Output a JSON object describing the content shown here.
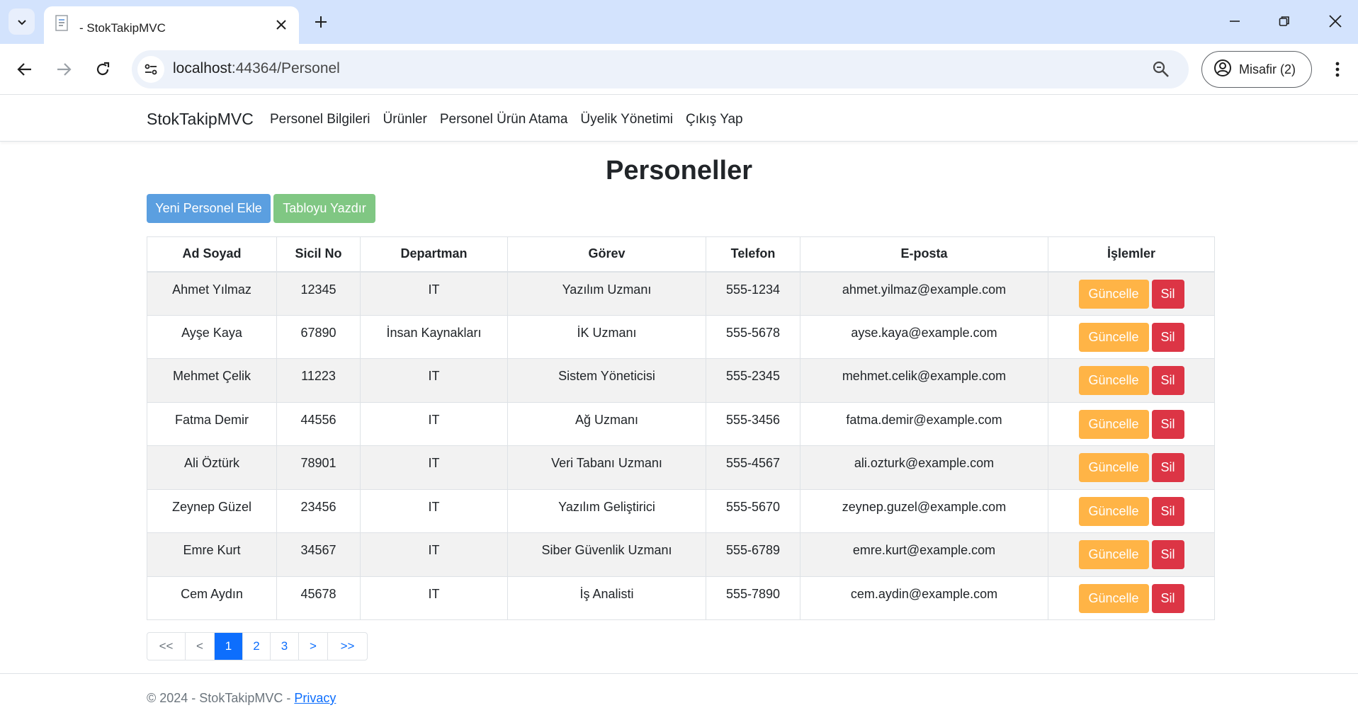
{
  "browser": {
    "tab_title": "- StokTakipMVC",
    "url_host": "localhost",
    "url_path": ":44364/Personel",
    "profile_label": "Misafir (2)",
    "icons": [
      "tab-list-icon",
      "favicon-icon",
      "close-icon",
      "plus-icon",
      "minimize-icon",
      "restore-icon",
      "close-window-icon",
      "back-arrow-icon",
      "forward-arrow-icon",
      "reload-icon",
      "site-info-icon",
      "zoom-icon",
      "profile-icon",
      "more-vert-icon"
    ]
  },
  "navbar": {
    "brand": "StokTakipMVC",
    "links": [
      "Personel Bilgileri",
      "Ürünler",
      "Personel Ürün Atama",
      "Üyelik Yönetimi",
      "Çıkış Yap"
    ]
  },
  "main": {
    "title": "Personeller",
    "add_button": "Yeni Personel Ekle",
    "print_button": "Tabloyu Yazdır"
  },
  "table": {
    "headers": [
      "Ad Soyad",
      "Sicil No",
      "Departman",
      "Görev",
      "Telefon",
      "E-posta",
      "İşlemler"
    ],
    "update_label": "Güncelle",
    "delete_label": "Sil",
    "rows": [
      [
        "Ahmet Yılmaz",
        "12345",
        "IT",
        "Yazılım Uzmanı",
        "555-1234",
        "ahmet.yilmaz@example.com"
      ],
      [
        "Ayşe Kaya",
        "67890",
        "İnsan Kaynakları",
        "İK Uzmanı",
        "555-5678",
        "ayse.kaya@example.com"
      ],
      [
        "Mehmet Çelik",
        "11223",
        "IT",
        "Sistem Yöneticisi",
        "555-2345",
        "mehmet.celik@example.com"
      ],
      [
        "Fatma Demir",
        "44556",
        "IT",
        "Ağ Uzmanı",
        "555-3456",
        "fatma.demir@example.com"
      ],
      [
        "Ali Öztürk",
        "78901",
        "IT",
        "Veri Tabanı Uzmanı",
        "555-4567",
        "ali.ozturk@example.com"
      ],
      [
        "Zeynep Güzel",
        "23456",
        "IT",
        "Yazılım Geliştirici",
        "555-5670",
        "zeynep.guzel@example.com"
      ],
      [
        "Emre Kurt",
        "34567",
        "IT",
        "Siber Güvenlik Uzmanı",
        "555-6789",
        "emre.kurt@example.com"
      ],
      [
        "Cem Aydın",
        "45678",
        "IT",
        "İş Analisti",
        "555-7890",
        "cem.aydin@example.com"
      ]
    ]
  },
  "pagination": {
    "items": [
      "<<",
      "<",
      "1",
      "2",
      "3",
      ">",
      ">>"
    ],
    "active": "1"
  },
  "footer": {
    "text": "© 2024 - StokTakipMVC - ",
    "link": "Privacy"
  },
  "colors": {
    "primary": "#5b9fe0",
    "success": "#80c783",
    "warning": "#ffb446",
    "danger": "#dc3545",
    "link": "#0d6efd",
    "chrome": "#d3e3fd"
  }
}
